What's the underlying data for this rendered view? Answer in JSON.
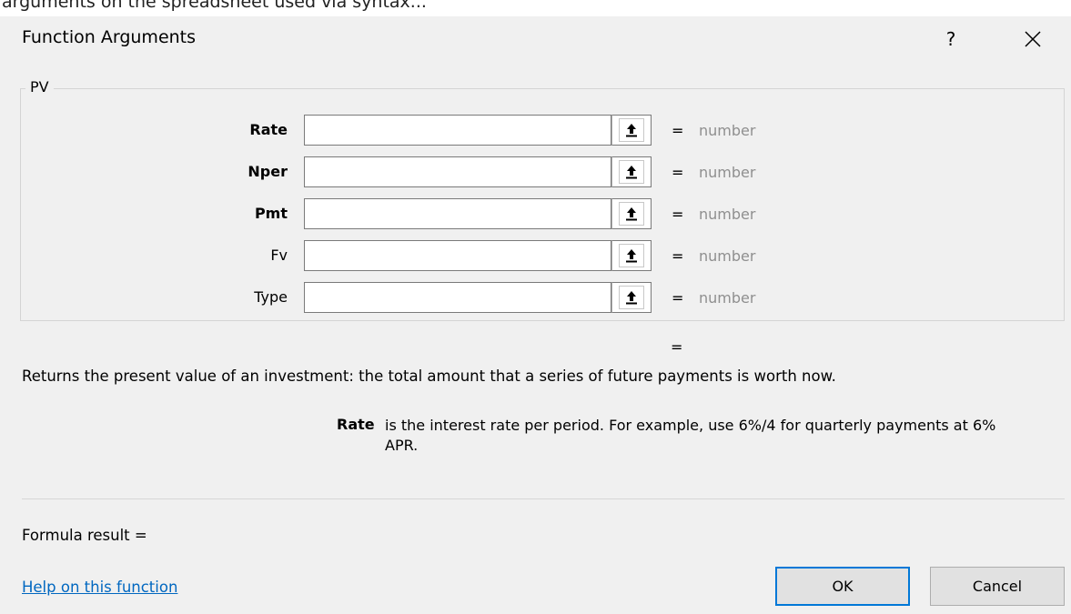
{
  "background_caption": "arguments on the spreadsheet used via syntax...",
  "window": {
    "title": "Function Arguments",
    "help_label": "?",
    "close_icon": "close-icon"
  },
  "function_name": "PV",
  "arguments": [
    {
      "name": "Rate",
      "bold": true,
      "value": "",
      "result": "number"
    },
    {
      "name": "Nper",
      "bold": true,
      "value": "",
      "result": "number"
    },
    {
      "name": "Pmt",
      "bold": true,
      "value": "",
      "result": "number"
    },
    {
      "name": "Fv",
      "bold": false,
      "value": "",
      "result": "number"
    },
    {
      "name": "Type",
      "bold": false,
      "value": "",
      "result": "number"
    }
  ],
  "equals_sign": "=",
  "function_description": "Returns the present value of an investment: the total amount that a series of future payments is worth now.",
  "argument_help": {
    "name": "Rate",
    "text": "is the interest rate per period. For example, use 6%/4 for quarterly payments at 6% APR."
  },
  "formula_result_label": "Formula result =",
  "help_link": "Help on this function",
  "buttons": {
    "ok": "OK",
    "cancel": "Cancel"
  },
  "colors": {
    "link": "#0067c0",
    "default_button_border": "#0078d7",
    "placeholder_value": "#8f8f8f"
  }
}
